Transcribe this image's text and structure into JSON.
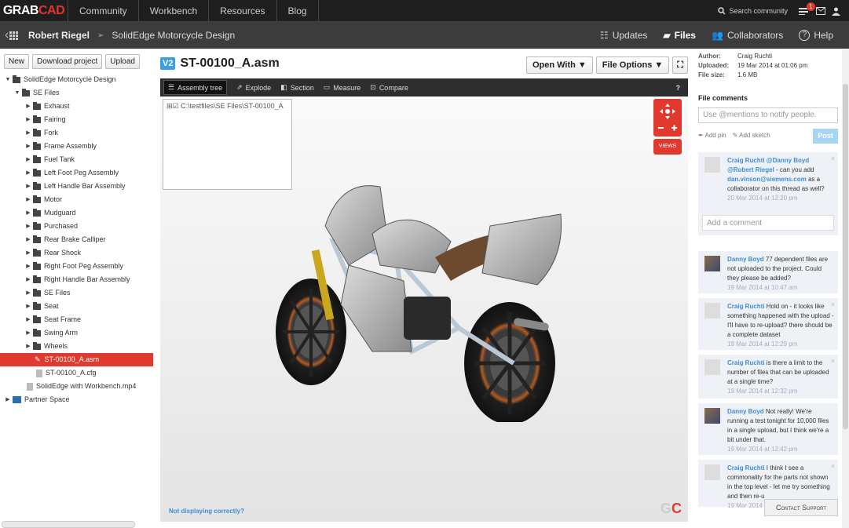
{
  "brand": {
    "logo_grab": "GRAB",
    "logo_cad": "CAD"
  },
  "topnav": [
    "Community",
    "Workbench",
    "Resources",
    "Blog"
  ],
  "search_label": "Search community",
  "notif_count": "1",
  "breadcrumb": {
    "user": "Robert Riegel",
    "project": "SolidEdge Motorcycle Design"
  },
  "subnav": {
    "updates": "Updates",
    "files": "Files",
    "collaborators": "Collaborators",
    "help": "Help"
  },
  "left_buttons": {
    "new": "New",
    "download": "Download project",
    "upload": "Upload"
  },
  "tree": {
    "root": "SolidEdge Motorcycle Design",
    "se_files": "SE Files",
    "folders": [
      "Exhaust",
      "Fairing",
      "Fork",
      "Frame Assembly",
      "Fuel Tank",
      "Left Foot Peg Assembly",
      "Left Handle Bar Assembly",
      "Motor",
      "Mudguard",
      "Purchased",
      "Rear Brake Calliper",
      "Rear Shock",
      "Right Foot Peg Assembly",
      "Right Handle Bar Assembly",
      "SE Files",
      "Seat",
      "Seat Frame",
      "Swing Arm",
      "Wheels"
    ],
    "selected_file": "ST-00100_A.asm",
    "cfg_file": "ST-00100_A.cfg",
    "mp4": "SolidEdge with Workbench.mp4",
    "partner": "Partner Space"
  },
  "file": {
    "version": "V2",
    "name": "ST-00100_A.asm"
  },
  "center_buttons": {
    "open_with": "Open With ▼",
    "file_options": "File Options ▼"
  },
  "viewer_toolbar": {
    "assembly_tree": "Assembly tree",
    "explode": "Explode",
    "section": "Section",
    "measure": "Measure",
    "compare": "Compare",
    "help": "?"
  },
  "asm_path": "C:\\testfiles\\SE Files\\ST-00100_A",
  "views_label": "VIEWS",
  "not_displaying": "Not displaying correctly?",
  "gc_g": "G",
  "gc_c": "C",
  "meta": {
    "author_k": "Author:",
    "author_v": "Craig Ruchti",
    "uploaded_k": "Uploaded:",
    "uploaded_v": "19 Mar 2014 at 01:06 pm",
    "size_k": "File size:",
    "size_v": "1.6 MB"
  },
  "comments_title": "File comments",
  "mention_placeholder": "Use @mentions to notify people.",
  "add_pin": "Add pin",
  "add_sketch": "Add sketch",
  "post": "Post",
  "add_comment": "Add a comment",
  "thread": {
    "name": "Craig Ruchti",
    "mention1": "@Danny Boyd",
    "mention2": "@Robert Riegel",
    "text1": " - can you add ",
    "email": "dan.vinson@siemens.com",
    "text2": " as a collaborator on this thread as well?",
    "time": "20 Mar 2014 at 12:20 pm"
  },
  "comments": [
    {
      "name": "Danny Boyd",
      "text": " 77 dependent files are not uploaded to the project. Could they please be added?",
      "time": "19 Mar 2014 at 10:47 am"
    },
    {
      "name": "Craig Ruchti",
      "text": " Hold on - it looks like something happened with the upload - I'll have to re-upload? there should be a complete dataset",
      "time": "19 Mar 2014 at 12:29 pm"
    },
    {
      "name": "Craig Ruchti",
      "text": " is there a limit to the number of files that can be uploaded at a single time?",
      "time": "19 Mar 2014 at 12:32 pm"
    },
    {
      "name": "Danny Boyd",
      "text": " Not really! We're running a test tonight for 10,000 files in a single upload, but I think we're a bit under that.",
      "time": "19 Mar 2014 at 12:42 pm"
    },
    {
      "name": "Craig Ruchti",
      "text": " I think I see a commonality for the parts not shown in the top level - let me try something and then re-u",
      "time": "19 Mar 2014"
    }
  ],
  "contact_support": "Contact Support"
}
